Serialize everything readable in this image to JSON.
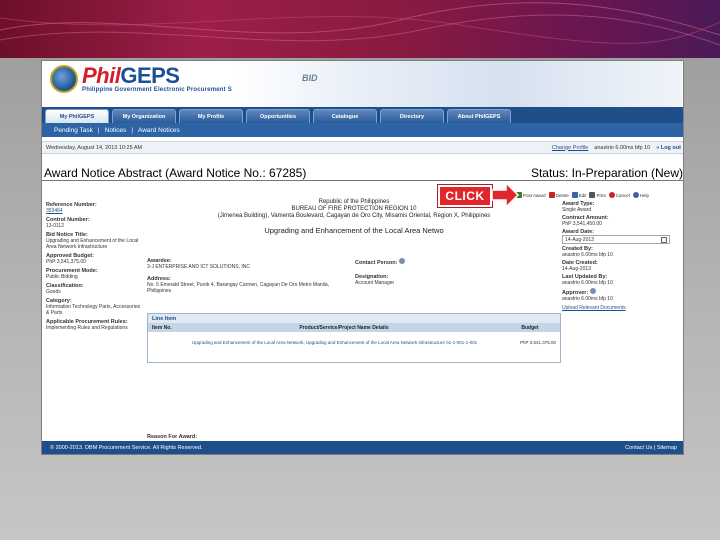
{
  "app": {
    "logo_phil": "Phil",
    "logo_geps": "GEPS",
    "logo_subtitle": "Philippine Government Electronic Procurement System",
    "banner_art_text": "BID"
  },
  "nav": {
    "tabs": [
      {
        "label": "My PhilGEPS",
        "active": true
      },
      {
        "label": "My Organization",
        "active": false
      },
      {
        "label": "My Profile",
        "active": false
      },
      {
        "label": "Opportunities",
        "active": false
      },
      {
        "label": "Catalogue",
        "active": false
      },
      {
        "label": "Directory",
        "active": false
      },
      {
        "label": "About PhilGEPS",
        "active": false
      }
    ],
    "subnav": [
      "Pending Task",
      "|",
      "Notices",
      "|",
      "Award Notices"
    ]
  },
  "infobar": {
    "datetime": "Wednesday, August 14, 2013 10:25 AM",
    "user_link": "Change Profile",
    "user_name": "anastrio 6.00ms bfp 10",
    "logout": "Log out"
  },
  "page": {
    "title": "Award Notice Abstract (Award Notice No.: 67285)",
    "status": "Status: In-Preparation (New)"
  },
  "toolbar": {
    "items": [
      {
        "label": "Post Award",
        "icon": "post-award-icon",
        "color": "#3a7d2c"
      },
      {
        "label": "Delete",
        "icon": "delete-icon",
        "color": "#cc2222"
      },
      {
        "label": "Edit",
        "icon": "edit-icon",
        "color": "#3a64a8"
      },
      {
        "label": "Print",
        "icon": "print-icon",
        "color": "#555555"
      },
      {
        "label": "Cancel",
        "icon": "cancel-icon",
        "color": "#cc2222"
      },
      {
        "label": "Help",
        "icon": "help-icon",
        "color": "#3a64a8"
      }
    ]
  },
  "left": {
    "ref_label": "Reference Number:",
    "ref_value": "353464",
    "control_label": "Control Number:",
    "control_value": "13-0112",
    "bid_title_label": "Bid Notice Title:",
    "bid_title_value": "Upgrading and Enhancement of the Local Area Network Infrastructure",
    "budget_label": "Approved Budget:",
    "budget_value": "PhP 3,541,375.00",
    "mode_label": "Procurement Mode:",
    "mode_value": "Public Bidding",
    "class_label": "Classification:",
    "class_value": "Goods",
    "category_label": "Category:",
    "category_value": "Information Technology Parts, Accessories & Parts",
    "rules_label": "Applicable Procurement Rules:",
    "rules_value": "Implementing Rules and Regulations"
  },
  "center": {
    "agency_line1": "Republic of the Philippines",
    "agency_line2": "BUREAU OF FIRE PROTECTION REGION 10",
    "agency_line3": "(Jimenea Building), Vamenta Boulevard, Cagayan de Oro City, Misamis Oriental, Region X, Philippines",
    "doc_title": "Upgrading and Enhancement of the Local Area Netwo",
    "awardee_label": "Awardee:",
    "awardee_value": "3-J ENTERPRISE AND ICT SOLUTIONS, INC",
    "address_label": "Address:",
    "address_value": "No. 5 Emerald Street, Purok 4, Barangay Carmen, Cagayan De Oro Metro Manila, Philippines",
    "contact_label": "Contact Person:",
    "designation_label": "Designation:",
    "designation_value": "Account Manager",
    "lineitem_header": "Line Item",
    "col_item": "Item No.",
    "col_details": "Product/Service/Project Name Details",
    "col_budget": "Budget",
    "row_details": "Upgrading and Enhancement of the Local Area Network, Upgrading and Enhancement of the Local Area Network Infrastructure 01-1-001-1-001",
    "row_budget": "PhP 3,541,375.00",
    "reason_label": "Reason For Award:"
  },
  "right": {
    "award_type_label": "Award Type:",
    "award_type_value": "Single Award",
    "contract_label": "Contract Amount:",
    "contract_value": "PhP 3,541,450.00",
    "award_date_label": "Award Date:",
    "award_date_value": "14-Aug-2013",
    "created_by_label": "Created By:",
    "created_by_value": "anastrio 6.00ms bfp 10",
    "date_created_label": "Date Created:",
    "date_created_value": "14-Aug-2013",
    "updated_by_label": "Last Updated By:",
    "updated_by_value": "anastrio 6.00ms bfp 10",
    "approver_label": "Approver:",
    "approver_value": "anastrio 6.00ms bfp 10",
    "upload_link": "Upload Relevant Documents"
  },
  "footer": {
    "copyright": "© 2000-2013. DBM Procurement Service. All Rights Reserved.",
    "links": "Contact Us | Sitemap"
  },
  "callout": {
    "label": "CLICK",
    "color": "#e1262e"
  }
}
